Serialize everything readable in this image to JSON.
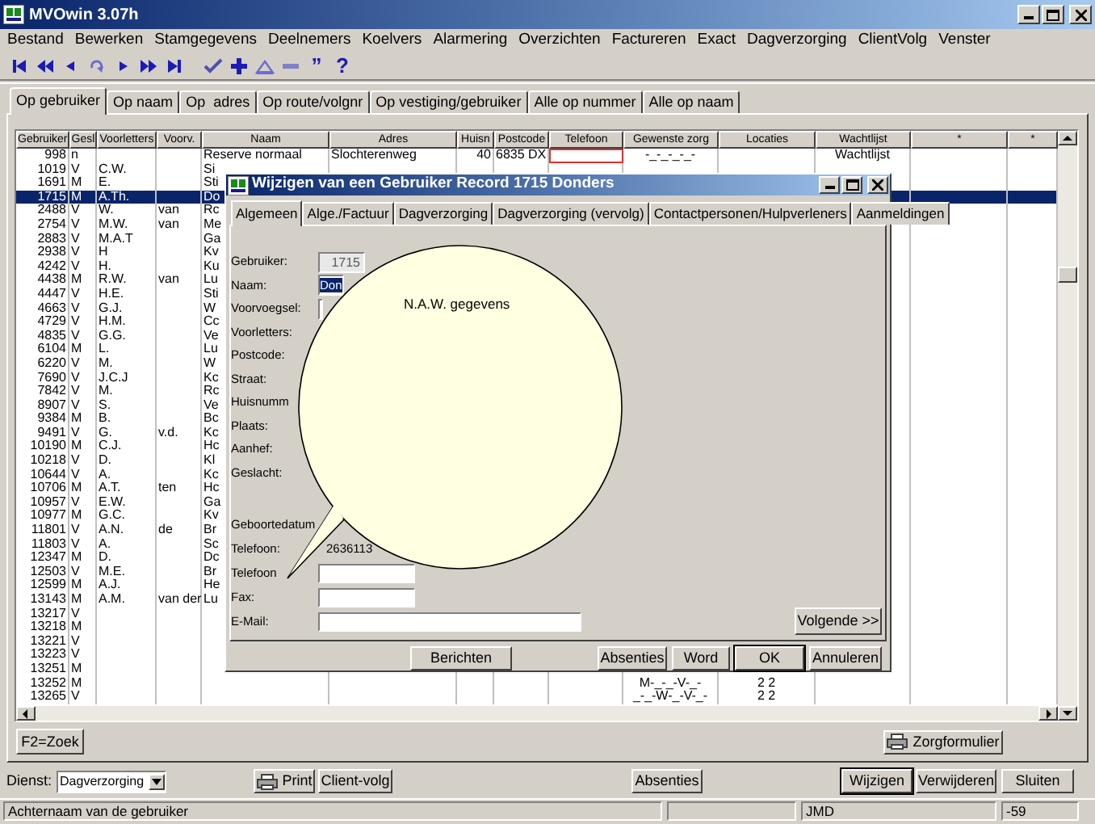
{
  "window": {
    "title": "MVOwin 3.07h"
  },
  "menu": [
    "Bestand",
    "Bewerken",
    "Stamgegevens",
    "Deelnemers",
    "Koelvers",
    "Alarmering",
    "Overzichten",
    "Factureren",
    "Exact",
    "Dagverzorging",
    "ClientVolg",
    "Venster"
  ],
  "toolbar": [
    {
      "kind": "first"
    },
    {
      "kind": "rewind"
    },
    {
      "kind": "prev"
    },
    {
      "kind": "undo"
    },
    {
      "kind": "next"
    },
    {
      "kind": "forward"
    },
    {
      "kind": "last"
    },
    {
      "kind": "check"
    },
    {
      "kind": "plus"
    },
    {
      "kind": "triangle"
    },
    {
      "kind": "minus"
    },
    {
      "kind": "glyph",
      "text": "”"
    },
    {
      "kind": "glyph",
      "text": "?"
    }
  ],
  "tabs": [
    {
      "label": "Op gebruiker",
      "selected": true
    },
    {
      "label": "Op naam",
      "selected": false
    },
    {
      "label": "Op  adres",
      "selected": false
    },
    {
      "label": "Op route/volgnr",
      "selected": false
    },
    {
      "label": "Op vestiging/gebruiker",
      "selected": false
    },
    {
      "label": "Alle op nummer",
      "selected": false
    },
    {
      "label": "Alle op naam",
      "selected": false
    }
  ],
  "table": {
    "columns": [
      "Gebruiker",
      "Gesl",
      "Voorletters",
      "Voorv.",
      "Naam",
      "Adres",
      "Huisn",
      "Postcode",
      "Telefoon",
      "Gewenste zorg",
      "Locaties",
      "Wachtlijst",
      "*",
      "*"
    ],
    "rows": [
      {
        "selected": false,
        "cells": [
          "998",
          "n",
          null,
          null,
          "Reserve normaal",
          "Slochterenweg",
          "40",
          "6835 DX",
          {
            "focused": true
          },
          "-_-_-_-_-",
          null,
          "Wachtlijst"
        ]
      },
      {
        "selected": false,
        "cells": [
          "1019",
          "V",
          "C.W.",
          null,
          "Si"
        ]
      },
      {
        "selected": false,
        "cells": [
          "1691",
          "M",
          "E.",
          null,
          "Sti"
        ]
      },
      {
        "selected": true,
        "cells": [
          "1715",
          "M",
          "A.Th.",
          null,
          "Do"
        ]
      },
      {
        "selected": false,
        "cells": [
          "2488",
          "V",
          "W.",
          "van",
          "Rc"
        ]
      },
      {
        "selected": false,
        "cells": [
          "2754",
          "V",
          "M.W.",
          "van",
          "Me"
        ]
      },
      {
        "selected": false,
        "cells": [
          "2883",
          "V",
          "M.A.T",
          null,
          "Ga"
        ]
      },
      {
        "selected": false,
        "cells": [
          "2938",
          "V",
          "H",
          null,
          "Kv"
        ]
      },
      {
        "selected": false,
        "cells": [
          "4242",
          "V",
          "H.",
          null,
          "Ku"
        ]
      },
      {
        "selected": false,
        "cells": [
          "4438",
          "M",
          "R.W.",
          "van",
          "Lu"
        ]
      },
      {
        "selected": false,
        "cells": [
          "4447",
          "V",
          "H.E.",
          null,
          "Sti"
        ]
      },
      {
        "selected": false,
        "cells": [
          "4663",
          "V",
          "G.J.",
          null,
          "W"
        ]
      },
      {
        "selected": false,
        "cells": [
          "4729",
          "V",
          "H.M.",
          null,
          "Cc"
        ]
      },
      {
        "selected": false,
        "cells": [
          "4835",
          "V",
          "G.G.",
          null,
          "Ve"
        ]
      },
      {
        "selected": false,
        "cells": [
          "6104",
          "M",
          "L.",
          null,
          "Lu"
        ]
      },
      {
        "selected": false,
        "cells": [
          "6220",
          "V",
          "M.",
          null,
          "W"
        ]
      },
      {
        "selected": false,
        "cells": [
          "7690",
          "V",
          "J.C.J",
          null,
          "Kc"
        ]
      },
      {
        "selected": false,
        "cells": [
          "7842",
          "V",
          "M.",
          null,
          "Rc"
        ]
      },
      {
        "selected": false,
        "cells": [
          "8907",
          "V",
          "S.",
          null,
          "Ve"
        ]
      },
      {
        "selected": false,
        "cells": [
          "9384",
          "M",
          "B.",
          null,
          "Bc"
        ]
      },
      {
        "selected": false,
        "cells": [
          "9491",
          "V",
          "G.",
          "v.d.",
          "Kc"
        ]
      },
      {
        "selected": false,
        "cells": [
          "10190",
          "M",
          "C.J.",
          null,
          "Hc"
        ]
      },
      {
        "selected": false,
        "cells": [
          "10218",
          "V",
          "D.",
          null,
          "Kl"
        ]
      },
      {
        "selected": false,
        "cells": [
          "10644",
          "V",
          "A.",
          null,
          "Kc"
        ]
      },
      {
        "selected": false,
        "cells": [
          "10706",
          "M",
          "A.T.",
          "ten",
          "Hc"
        ]
      },
      {
        "selected": false,
        "cells": [
          "10957",
          "V",
          "E.W.",
          null,
          "Ga"
        ]
      },
      {
        "selected": false,
        "cells": [
          "10977",
          "M",
          "G.C.",
          null,
          "Kv"
        ]
      },
      {
        "selected": false,
        "cells": [
          "11801",
          "V",
          "A.N.",
          "de",
          "Br"
        ]
      },
      {
        "selected": false,
        "cells": [
          "11803",
          "V",
          "A.",
          null,
          "Sc"
        ]
      },
      {
        "selected": false,
        "cells": [
          "12347",
          "M",
          "D.",
          null,
          "Dc"
        ]
      },
      {
        "selected": false,
        "cells": [
          "12503",
          "V",
          "M.E.",
          null,
          "Br"
        ]
      },
      {
        "selected": false,
        "cells": [
          "12599",
          "M",
          "A.J.",
          null,
          "He"
        ]
      },
      {
        "selected": false,
        "cells": [
          "13143",
          "M",
          "A.M.",
          "van der",
          "Lu"
        ]
      },
      {
        "selected": false,
        "cells": [
          "13217",
          "V"
        ]
      },
      {
        "selected": false,
        "cells": [
          "13218",
          "M"
        ]
      },
      {
        "selected": false,
        "cells": [
          "13221",
          "V"
        ]
      },
      {
        "selected": false,
        "cells": [
          "13223",
          "V"
        ]
      },
      {
        "selected": false,
        "cells": [
          "13251",
          "M"
        ]
      },
      {
        "selected": false,
        "cells": [
          "13252",
          "M",
          null,
          null,
          null,
          null,
          null,
          null,
          null,
          "M-_-_-V-_-",
          "2 2"
        ]
      },
      {
        "selected": false,
        "cells": [
          "13265",
          "V",
          null,
          null,
          null,
          null,
          null,
          null,
          null,
          "_-_-W-_-V-_-",
          "2 2"
        ]
      }
    ]
  },
  "panel_buttons": [
    "F2=Zoek",
    "Zorgformulier"
  ],
  "dialog": {
    "title": "Wijzigen van een Gebruiker Record 1715 Donders",
    "tabs": [
      {
        "label": "Algemeen",
        "selected": true
      },
      {
        "label": "Alge./Factuur",
        "selected": false
      },
      {
        "label": "Dagverzorging",
        "selected": false
      },
      {
        "label": "Dagverzorging (vervolg)",
        "selected": false
      },
      {
        "label": "Contactpersonen/Hulpverleners",
        "selected": false
      },
      {
        "label": "Aanmeldingen",
        "selected": false
      }
    ],
    "naw_fields": [
      {
        "label": "Gebruiker:",
        "kind": "readonly",
        "value": "1715"
      },
      {
        "label": "Naam:",
        "kind": "highlighted",
        "value": "Don"
      },
      {
        "label": "Voorvoegsel:",
        "kind": "sliver"
      },
      {
        "label": "Voorletters:",
        "kind": "hidden"
      },
      {
        "label": "Postcode:",
        "kind": "hidden"
      },
      {
        "label": "Straat:",
        "kind": "hidden"
      },
      {
        "label": "Huisnumm",
        "kind": "hidden"
      },
      {
        "label": "Plaats:",
        "kind": "hidden"
      },
      {
        "label": "Aanhef:",
        "kind": "hidden"
      },
      {
        "label": "Geslacht:",
        "kind": "hidden"
      }
    ],
    "contact_fields": [
      {
        "label": "Geboortedatum",
        "kind": "hidden"
      },
      {
        "label": "Telefoon:",
        "kind": "text",
        "value": "2636113"
      },
      {
        "label": "Telefoon",
        "kind": "short"
      },
      {
        "label": "Fax:",
        "kind": "short"
      },
      {
        "label": "E-Mail:",
        "kind": "long"
      }
    ],
    "next_button": "Volgende >>",
    "buttons": [
      {
        "label": "Berichten",
        "default": false
      },
      {
        "label": "Absenties",
        "default": false
      },
      {
        "label": "Word",
        "default": false
      },
      {
        "label": "OK",
        "default": true
      },
      {
        "label": "Annuleren",
        "default": false
      }
    ]
  },
  "balloon": {
    "text": "N.A.W. gegevens"
  },
  "bottom_bar": {
    "dienst_label": "Dienst:",
    "dienst_value": "Dagverzorging",
    "buttons": [
      {
        "label": "Print",
        "default": false
      },
      {
        "label": "Client-volg",
        "default": false
      },
      {
        "label": "Absenties",
        "default": false
      },
      {
        "label": "Wijzigen",
        "default": true
      },
      {
        "label": "Verwijderen",
        "default": false
      },
      {
        "label": "Sluiten",
        "default": false
      }
    ]
  },
  "status_bar": [
    "Achternaam van de gebruiker",
    "JMD",
    "-59"
  ]
}
